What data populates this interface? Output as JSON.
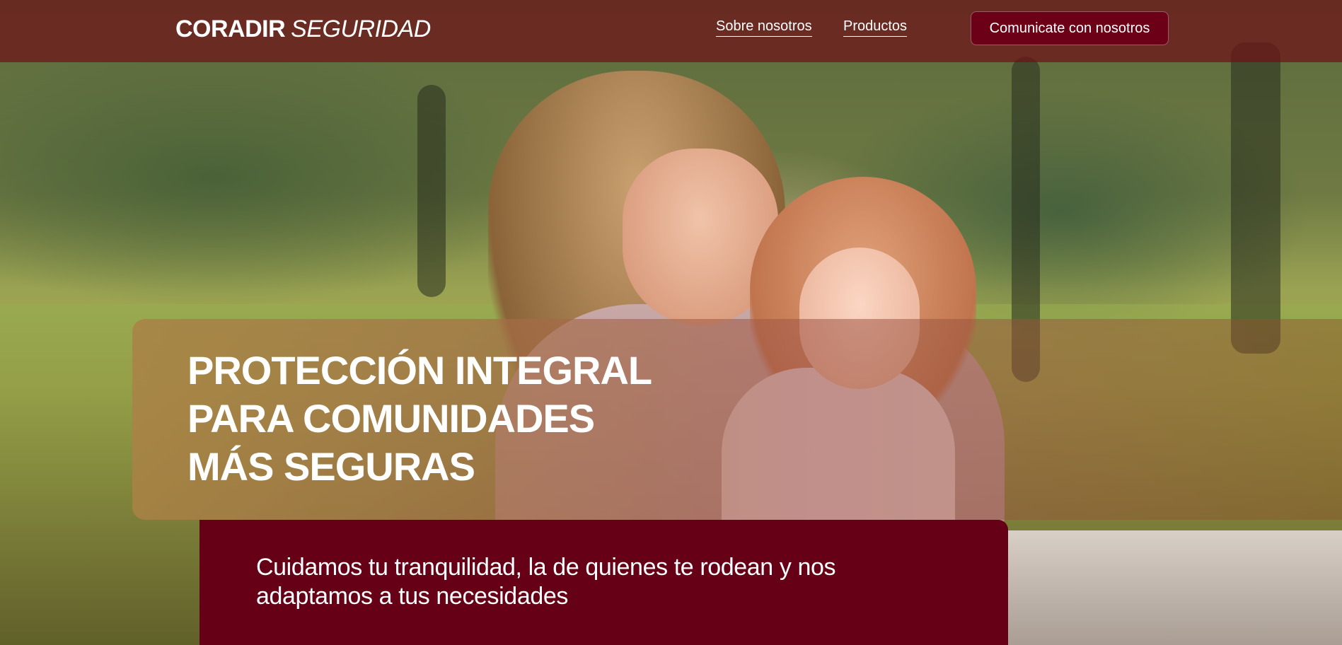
{
  "header": {
    "logo_bold": "CORADIR",
    "logo_light": "SEGURIDAD",
    "nav": {
      "about": "Sobre nosotros",
      "products": "Productos"
    },
    "cta": "Comunicate con nosotros"
  },
  "hero": {
    "headline": [
      "PROTECCIÓN INTEGRAL",
      "PARA COMUNIDADES",
      "MÁS SEGURAS"
    ],
    "subtitle": "Cuidamos tu tranquilidad, la de quienes te rodean y nos adaptamos a tus necesidades"
  },
  "colors": {
    "brand": "#660016",
    "header_overlay": "#6e1218",
    "text": "#ffffff"
  }
}
